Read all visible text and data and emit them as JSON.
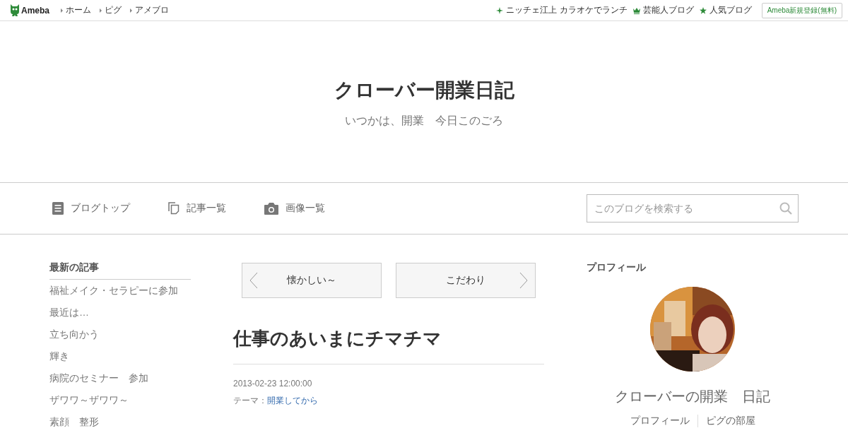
{
  "top_bar": {
    "logo": "Ameba",
    "links": [
      "ホーム",
      "ピグ",
      "アメブロ"
    ],
    "right_links": [
      {
        "kind": "sparkle",
        "label": "ニッチェ江上 カラオケでランチ"
      },
      {
        "kind": "crown",
        "label": "芸能人ブログ"
      },
      {
        "kind": "star",
        "label": "人気ブログ"
      }
    ],
    "register_button": "Ameba新規登録(無料)"
  },
  "header": {
    "title": "クローバー開業日記",
    "subtitle": "いつかは、開業　今日このごろ"
  },
  "nav": {
    "items": [
      {
        "kind": "document",
        "label": "ブログトップ"
      },
      {
        "kind": "pages",
        "label": "記事一覧"
      },
      {
        "kind": "camera",
        "label": "画像一覧"
      }
    ],
    "search": {
      "placeholder": "このブログを検索する"
    }
  },
  "sidebar": {
    "title": "最新の記事",
    "items": [
      "福祉メイク・セラピーに参加",
      "最近は…",
      "立ち向かう",
      "輝き",
      "病院のセミナー　参加",
      "ザワワ～ザワワ～",
      "素顔　整形"
    ]
  },
  "article": {
    "prev": "懐かしい～",
    "next": "こだわり",
    "title": "仕事のあいまにチマチマ",
    "date": "2013-02-23 12:00:00",
    "theme_label": "テーマ：",
    "theme": "開業してから"
  },
  "profile": {
    "title": "プロフィール",
    "avatar": {
      "kind": "picture"
    },
    "name": "クローバーの開業　日記",
    "links": [
      "プロフィール",
      "ピグの部屋"
    ]
  }
}
